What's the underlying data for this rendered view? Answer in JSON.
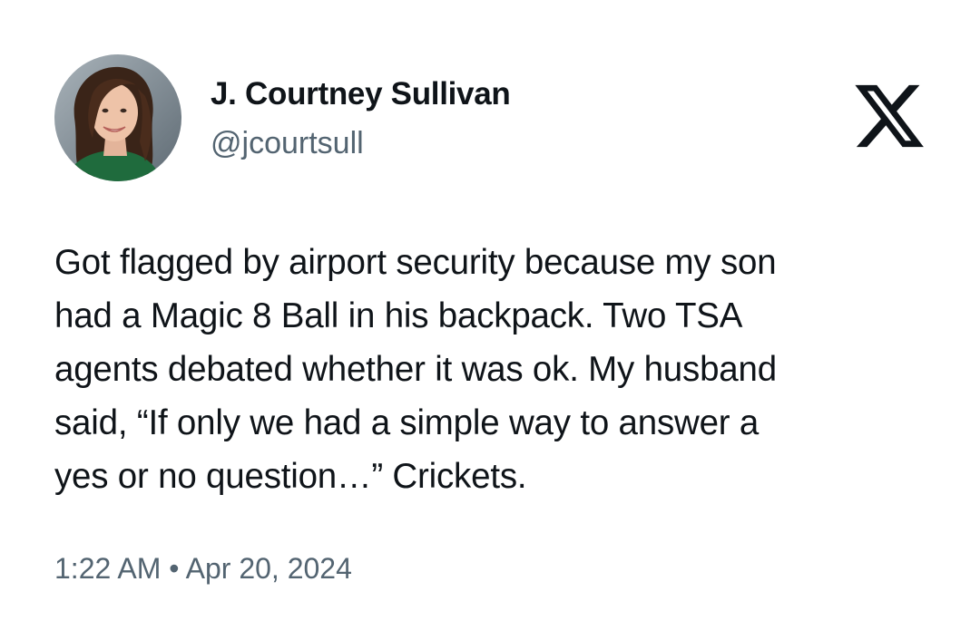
{
  "tweet": {
    "author": {
      "name": "J. Courtney Sullivan",
      "handle": "@jcourtsull",
      "avatar": "profile-photo"
    },
    "platform_icon": "x-logo-icon",
    "text_lines": [
      "Got flagged by airport security because my son",
      "had a Magic 8 Ball in his backpack. Two TSA",
      "agents debated whether it was ok. My husband",
      "said, “If only we had a simple way to answer a",
      "yes or no question…” Crickets."
    ],
    "time": "1:22 AM",
    "separator": "•",
    "date": "Apr 20, 2024"
  },
  "colors": {
    "text": "#0f1419",
    "muted": "#536471",
    "background": "#ffffff"
  }
}
